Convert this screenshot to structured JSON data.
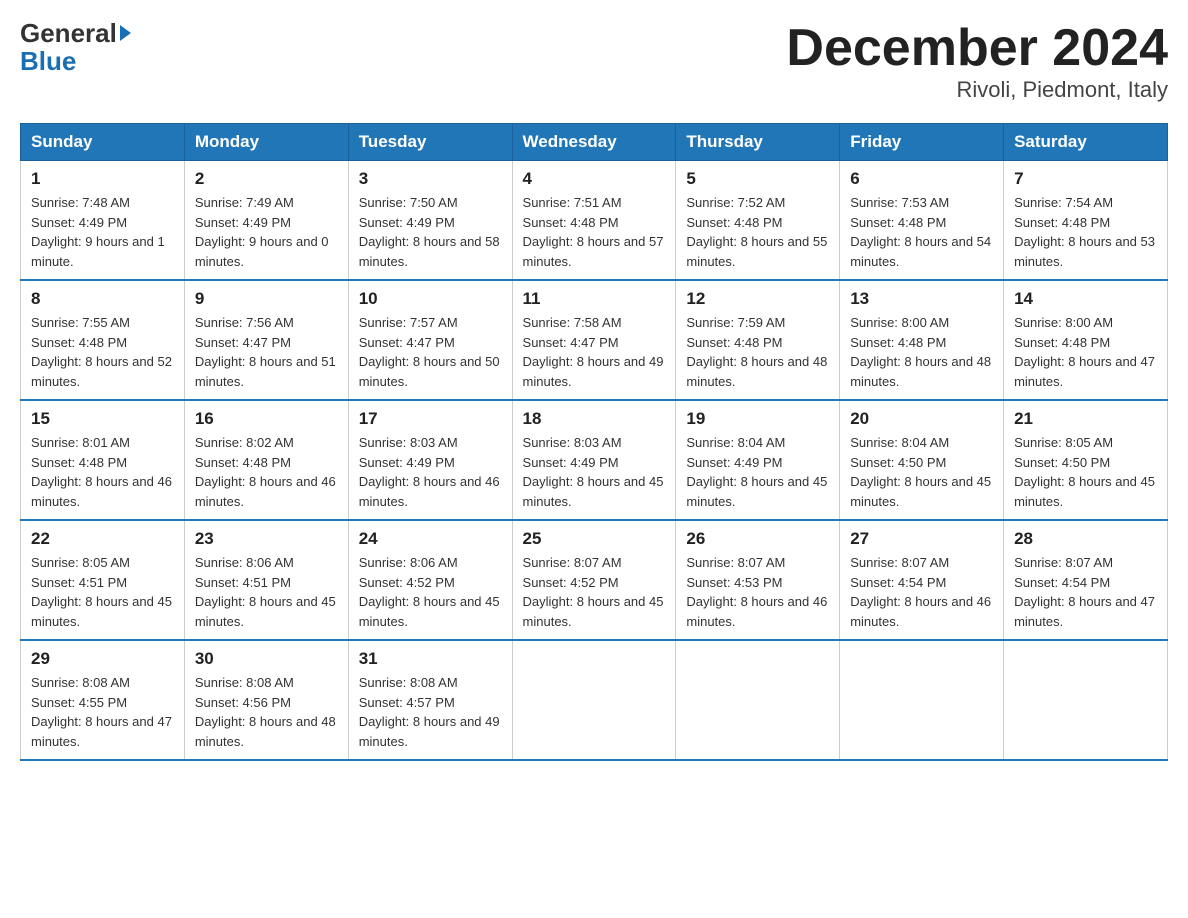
{
  "header": {
    "logo_general": "General",
    "logo_blue": "Blue",
    "title": "December 2024",
    "subtitle": "Rivoli, Piedmont, Italy"
  },
  "weekdays": [
    "Sunday",
    "Monday",
    "Tuesday",
    "Wednesday",
    "Thursday",
    "Friday",
    "Saturday"
  ],
  "weeks": [
    [
      {
        "day": "1",
        "sunrise": "7:48 AM",
        "sunset": "4:49 PM",
        "daylight": "9 hours and 1 minute."
      },
      {
        "day": "2",
        "sunrise": "7:49 AM",
        "sunset": "4:49 PM",
        "daylight": "9 hours and 0 minutes."
      },
      {
        "day": "3",
        "sunrise": "7:50 AM",
        "sunset": "4:49 PM",
        "daylight": "8 hours and 58 minutes."
      },
      {
        "day": "4",
        "sunrise": "7:51 AM",
        "sunset": "4:48 PM",
        "daylight": "8 hours and 57 minutes."
      },
      {
        "day": "5",
        "sunrise": "7:52 AM",
        "sunset": "4:48 PM",
        "daylight": "8 hours and 55 minutes."
      },
      {
        "day": "6",
        "sunrise": "7:53 AM",
        "sunset": "4:48 PM",
        "daylight": "8 hours and 54 minutes."
      },
      {
        "day": "7",
        "sunrise": "7:54 AM",
        "sunset": "4:48 PM",
        "daylight": "8 hours and 53 minutes."
      }
    ],
    [
      {
        "day": "8",
        "sunrise": "7:55 AM",
        "sunset": "4:48 PM",
        "daylight": "8 hours and 52 minutes."
      },
      {
        "day": "9",
        "sunrise": "7:56 AM",
        "sunset": "4:47 PM",
        "daylight": "8 hours and 51 minutes."
      },
      {
        "day": "10",
        "sunrise": "7:57 AM",
        "sunset": "4:47 PM",
        "daylight": "8 hours and 50 minutes."
      },
      {
        "day": "11",
        "sunrise": "7:58 AM",
        "sunset": "4:47 PM",
        "daylight": "8 hours and 49 minutes."
      },
      {
        "day": "12",
        "sunrise": "7:59 AM",
        "sunset": "4:48 PM",
        "daylight": "8 hours and 48 minutes."
      },
      {
        "day": "13",
        "sunrise": "8:00 AM",
        "sunset": "4:48 PM",
        "daylight": "8 hours and 48 minutes."
      },
      {
        "day": "14",
        "sunrise": "8:00 AM",
        "sunset": "4:48 PM",
        "daylight": "8 hours and 47 minutes."
      }
    ],
    [
      {
        "day": "15",
        "sunrise": "8:01 AM",
        "sunset": "4:48 PM",
        "daylight": "8 hours and 46 minutes."
      },
      {
        "day": "16",
        "sunrise": "8:02 AM",
        "sunset": "4:48 PM",
        "daylight": "8 hours and 46 minutes."
      },
      {
        "day": "17",
        "sunrise": "8:03 AM",
        "sunset": "4:49 PM",
        "daylight": "8 hours and 46 minutes."
      },
      {
        "day": "18",
        "sunrise": "8:03 AM",
        "sunset": "4:49 PM",
        "daylight": "8 hours and 45 minutes."
      },
      {
        "day": "19",
        "sunrise": "8:04 AM",
        "sunset": "4:49 PM",
        "daylight": "8 hours and 45 minutes."
      },
      {
        "day": "20",
        "sunrise": "8:04 AM",
        "sunset": "4:50 PM",
        "daylight": "8 hours and 45 minutes."
      },
      {
        "day": "21",
        "sunrise": "8:05 AM",
        "sunset": "4:50 PM",
        "daylight": "8 hours and 45 minutes."
      }
    ],
    [
      {
        "day": "22",
        "sunrise": "8:05 AM",
        "sunset": "4:51 PM",
        "daylight": "8 hours and 45 minutes."
      },
      {
        "day": "23",
        "sunrise": "8:06 AM",
        "sunset": "4:51 PM",
        "daylight": "8 hours and 45 minutes."
      },
      {
        "day": "24",
        "sunrise": "8:06 AM",
        "sunset": "4:52 PM",
        "daylight": "8 hours and 45 minutes."
      },
      {
        "day": "25",
        "sunrise": "8:07 AM",
        "sunset": "4:52 PM",
        "daylight": "8 hours and 45 minutes."
      },
      {
        "day": "26",
        "sunrise": "8:07 AM",
        "sunset": "4:53 PM",
        "daylight": "8 hours and 46 minutes."
      },
      {
        "day": "27",
        "sunrise": "8:07 AM",
        "sunset": "4:54 PM",
        "daylight": "8 hours and 46 minutes."
      },
      {
        "day": "28",
        "sunrise": "8:07 AM",
        "sunset": "4:54 PM",
        "daylight": "8 hours and 47 minutes."
      }
    ],
    [
      {
        "day": "29",
        "sunrise": "8:08 AM",
        "sunset": "4:55 PM",
        "daylight": "8 hours and 47 minutes."
      },
      {
        "day": "30",
        "sunrise": "8:08 AM",
        "sunset": "4:56 PM",
        "daylight": "8 hours and 48 minutes."
      },
      {
        "day": "31",
        "sunrise": "8:08 AM",
        "sunset": "4:57 PM",
        "daylight": "8 hours and 49 minutes."
      },
      null,
      null,
      null,
      null
    ]
  ],
  "labels": {
    "sunrise": "Sunrise:",
    "sunset": "Sunset:",
    "daylight": "Daylight:"
  }
}
